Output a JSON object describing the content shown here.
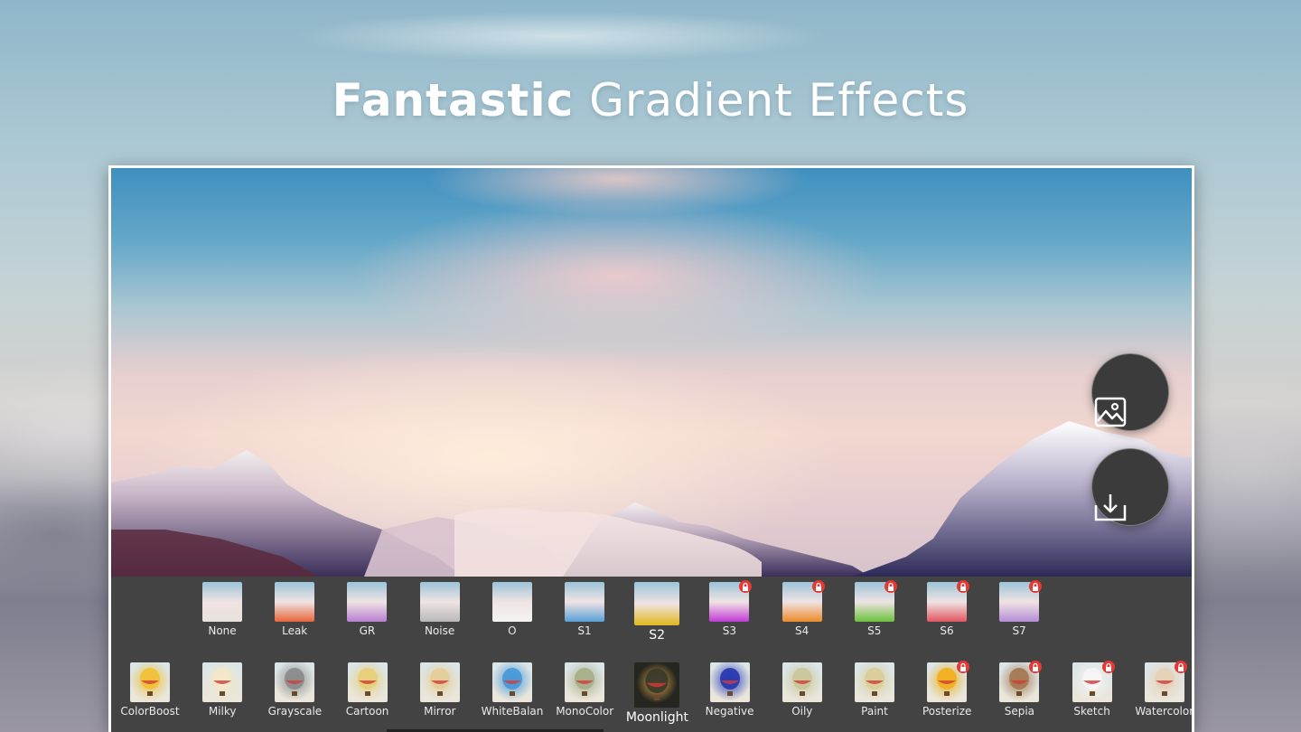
{
  "headline": {
    "bold": "Fantastic",
    "light": "Gradient Effects"
  },
  "actions": {
    "gallery_icon": "image-icon",
    "save_icon": "download-icon"
  },
  "filters_row": [
    {
      "label": "None",
      "locked": false,
      "tint": "#e8e2dc"
    },
    {
      "label": "Leak",
      "locked": false,
      "tint": "#e8663a"
    },
    {
      "label": "GR",
      "locked": false,
      "tint": "#b87fd1"
    },
    {
      "label": "Noise",
      "locked": false,
      "tint": "#b9b9b9"
    },
    {
      "label": "O",
      "locked": false,
      "tint": "#f4f4f4"
    },
    {
      "label": "S1",
      "locked": false,
      "tint": "#5aa0d8"
    },
    {
      "label": "S2",
      "locked": false,
      "tint": "#e0b81d",
      "selected": true
    },
    {
      "label": "S3",
      "locked": true,
      "tint": "#c23ad6"
    },
    {
      "label": "S4",
      "locked": true,
      "tint": "#ec8a2a"
    },
    {
      "label": "S5",
      "locked": true,
      "tint": "#6ac13a"
    },
    {
      "label": "S6",
      "locked": true,
      "tint": "#e0565f"
    },
    {
      "label": "S7",
      "locked": true,
      "tint": "#b68cd8"
    }
  ],
  "effects_row": [
    {
      "label": "ColorBoost",
      "locked": false,
      "tint": "#f0c23a"
    },
    {
      "label": "Milky",
      "locked": false,
      "tint": "#f2e8c8"
    },
    {
      "label": "Grayscale",
      "locked": false,
      "tint": "#8c8c8c"
    },
    {
      "label": "Cartoon",
      "locked": false,
      "tint": "#e7d07a"
    },
    {
      "label": "Mirror",
      "locked": false,
      "tint": "#e4cf9a"
    },
    {
      "label": "WhiteBalan",
      "locked": false,
      "tint": "#4a9ad8"
    },
    {
      "label": "MonoColor",
      "locked": false,
      "tint": "#a7b08a"
    },
    {
      "label": "Moonlight",
      "locked": false,
      "tint": "#3a3a2a",
      "selected": true
    },
    {
      "label": "Negative",
      "locked": false,
      "tint": "#2a3ab0"
    },
    {
      "label": "Oily",
      "locked": false,
      "tint": "#c9c79a"
    },
    {
      "label": "Paint",
      "locked": false,
      "tint": "#d8cf9a"
    },
    {
      "label": "Posterize",
      "locked": true,
      "tint": "#f0b020"
    },
    {
      "label": "Sepia",
      "locked": true,
      "tint": "#a57a55"
    },
    {
      "label": "Sketch",
      "locked": true,
      "tint": "#f4f4f4"
    },
    {
      "label": "Watercolor",
      "locked": true,
      "tint": "#e6d2b8"
    }
  ]
}
